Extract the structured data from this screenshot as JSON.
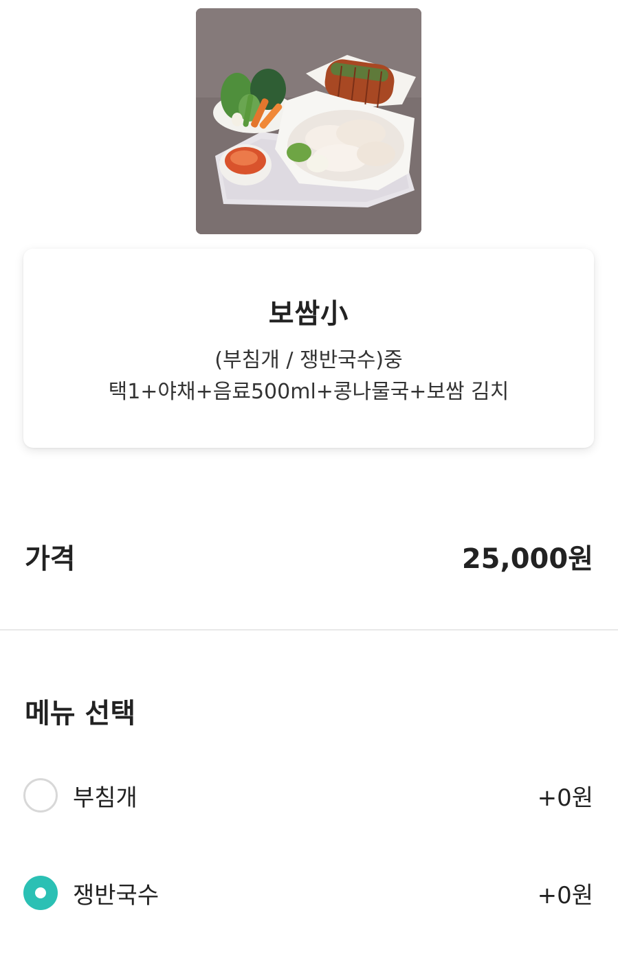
{
  "menu": {
    "name": "보쌈小",
    "description_line1": "(부침개 / 쟁반국수)중",
    "description_line2": "택1+야채+음료500ml+콩나물국+보쌈 김치"
  },
  "price": {
    "label": "가격",
    "value": "25,000원"
  },
  "menu_select": {
    "title": "메뉴 선택",
    "options": [
      {
        "label": "부침개",
        "price": "+0원",
        "selected": false
      },
      {
        "label": "쟁반국수",
        "price": "+0원",
        "selected": true
      }
    ]
  },
  "colors": {
    "accent": "#2bc0b4",
    "radio_border": "#d8d8d8",
    "divider": "#e8e8e8"
  }
}
